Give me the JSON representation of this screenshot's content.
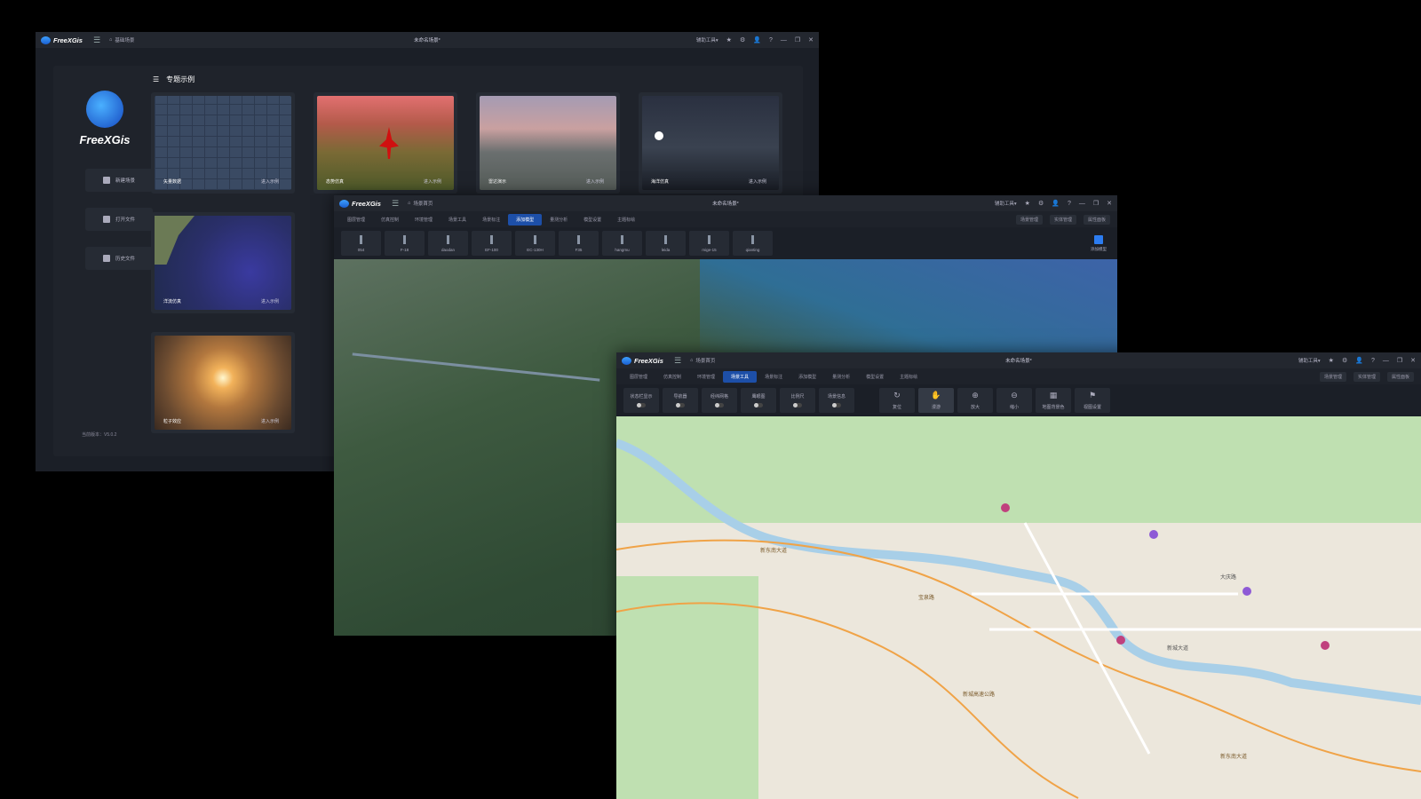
{
  "app": {
    "name": "FreeXGis",
    "unsaved": "未命名场景*",
    "func_tools": "辅助工具▾"
  },
  "win1": {
    "home_label": "基础场景",
    "section_title": "专题示例",
    "sidebar": [
      "新建场景",
      "打开文件",
      "历史文件"
    ],
    "version": "当前版本：V5.0.2",
    "enter": "进入示例",
    "cards": [
      {
        "label": "矢量数据"
      },
      {
        "label": "态势仿真"
      },
      {
        "label": "雷达演示"
      },
      {
        "label": "海洋仿真"
      },
      {
        "label": "洋流仿真"
      },
      {
        "label": "粒子效应"
      }
    ]
  },
  "win2": {
    "home_label": "场景首页",
    "tabs": [
      "图层管理",
      "仿真控制",
      "环境管理",
      "场景工具",
      "场景标注",
      "添加模型",
      "量测分析",
      "模型设置",
      "主题标绘"
    ],
    "active_tab": "添加模型",
    "right_btns": [
      "场景管理",
      "实体管理",
      "属性面板"
    ],
    "models": [
      "054",
      "F-18",
      "daodan",
      "EF-100",
      "EC-130H",
      "F35",
      "hangmu",
      "leida",
      "mige-15",
      "qianting"
    ],
    "side_label": "添加模型"
  },
  "win3": {
    "home_label": "场景首页",
    "tabs": [
      "图层管理",
      "仿真控制",
      "环境管理",
      "场景工具",
      "场景标注",
      "添加模型",
      "量测分析",
      "模型设置",
      "主题标绘"
    ],
    "active_tab": "场景工具",
    "right_btns": [
      "场景管理",
      "实体管理",
      "属性面板"
    ],
    "toggles": [
      "状态栏显示",
      "导航器",
      "经纬网格",
      "鹰眼图",
      "比例尺",
      "场景信息"
    ],
    "tools": [
      "复位",
      "漫游",
      "放大",
      "缩小",
      "地图背景色",
      "视图设置"
    ],
    "roads": [
      "新东南大道",
      "大庆路",
      "宝泉路",
      "新城大道",
      "新城高速公路",
      "新东南大道"
    ]
  }
}
